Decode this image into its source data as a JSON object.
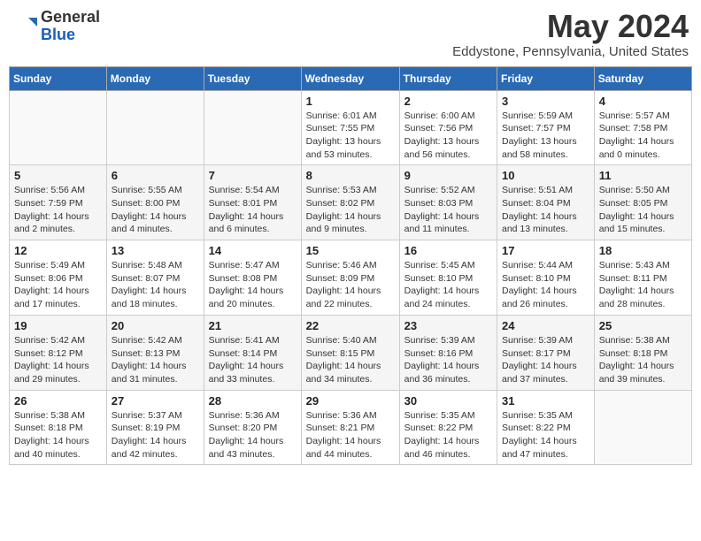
{
  "logo": {
    "general": "General",
    "blue": "Blue"
  },
  "title": "May 2024",
  "subtitle": "Eddystone, Pennsylvania, United States",
  "days_of_week": [
    "Sunday",
    "Monday",
    "Tuesday",
    "Wednesday",
    "Thursday",
    "Friday",
    "Saturday"
  ],
  "weeks": [
    [
      {
        "day": "",
        "info": ""
      },
      {
        "day": "",
        "info": ""
      },
      {
        "day": "",
        "info": ""
      },
      {
        "day": "1",
        "info": "Sunrise: 6:01 AM\nSunset: 7:55 PM\nDaylight: 13 hours\nand 53 minutes."
      },
      {
        "day": "2",
        "info": "Sunrise: 6:00 AM\nSunset: 7:56 PM\nDaylight: 13 hours\nand 56 minutes."
      },
      {
        "day": "3",
        "info": "Sunrise: 5:59 AM\nSunset: 7:57 PM\nDaylight: 13 hours\nand 58 minutes."
      },
      {
        "day": "4",
        "info": "Sunrise: 5:57 AM\nSunset: 7:58 PM\nDaylight: 14 hours\nand 0 minutes."
      }
    ],
    [
      {
        "day": "5",
        "info": "Sunrise: 5:56 AM\nSunset: 7:59 PM\nDaylight: 14 hours\nand 2 minutes."
      },
      {
        "day": "6",
        "info": "Sunrise: 5:55 AM\nSunset: 8:00 PM\nDaylight: 14 hours\nand 4 minutes."
      },
      {
        "day": "7",
        "info": "Sunrise: 5:54 AM\nSunset: 8:01 PM\nDaylight: 14 hours\nand 6 minutes."
      },
      {
        "day": "8",
        "info": "Sunrise: 5:53 AM\nSunset: 8:02 PM\nDaylight: 14 hours\nand 9 minutes."
      },
      {
        "day": "9",
        "info": "Sunrise: 5:52 AM\nSunset: 8:03 PM\nDaylight: 14 hours\nand 11 minutes."
      },
      {
        "day": "10",
        "info": "Sunrise: 5:51 AM\nSunset: 8:04 PM\nDaylight: 14 hours\nand 13 minutes."
      },
      {
        "day": "11",
        "info": "Sunrise: 5:50 AM\nSunset: 8:05 PM\nDaylight: 14 hours\nand 15 minutes."
      }
    ],
    [
      {
        "day": "12",
        "info": "Sunrise: 5:49 AM\nSunset: 8:06 PM\nDaylight: 14 hours\nand 17 minutes."
      },
      {
        "day": "13",
        "info": "Sunrise: 5:48 AM\nSunset: 8:07 PM\nDaylight: 14 hours\nand 18 minutes."
      },
      {
        "day": "14",
        "info": "Sunrise: 5:47 AM\nSunset: 8:08 PM\nDaylight: 14 hours\nand 20 minutes."
      },
      {
        "day": "15",
        "info": "Sunrise: 5:46 AM\nSunset: 8:09 PM\nDaylight: 14 hours\nand 22 minutes."
      },
      {
        "day": "16",
        "info": "Sunrise: 5:45 AM\nSunset: 8:10 PM\nDaylight: 14 hours\nand 24 minutes."
      },
      {
        "day": "17",
        "info": "Sunrise: 5:44 AM\nSunset: 8:10 PM\nDaylight: 14 hours\nand 26 minutes."
      },
      {
        "day": "18",
        "info": "Sunrise: 5:43 AM\nSunset: 8:11 PM\nDaylight: 14 hours\nand 28 minutes."
      }
    ],
    [
      {
        "day": "19",
        "info": "Sunrise: 5:42 AM\nSunset: 8:12 PM\nDaylight: 14 hours\nand 29 minutes."
      },
      {
        "day": "20",
        "info": "Sunrise: 5:42 AM\nSunset: 8:13 PM\nDaylight: 14 hours\nand 31 minutes."
      },
      {
        "day": "21",
        "info": "Sunrise: 5:41 AM\nSunset: 8:14 PM\nDaylight: 14 hours\nand 33 minutes."
      },
      {
        "day": "22",
        "info": "Sunrise: 5:40 AM\nSunset: 8:15 PM\nDaylight: 14 hours\nand 34 minutes."
      },
      {
        "day": "23",
        "info": "Sunrise: 5:39 AM\nSunset: 8:16 PM\nDaylight: 14 hours\nand 36 minutes."
      },
      {
        "day": "24",
        "info": "Sunrise: 5:39 AM\nSunset: 8:17 PM\nDaylight: 14 hours\nand 37 minutes."
      },
      {
        "day": "25",
        "info": "Sunrise: 5:38 AM\nSunset: 8:18 PM\nDaylight: 14 hours\nand 39 minutes."
      }
    ],
    [
      {
        "day": "26",
        "info": "Sunrise: 5:38 AM\nSunset: 8:18 PM\nDaylight: 14 hours\nand 40 minutes."
      },
      {
        "day": "27",
        "info": "Sunrise: 5:37 AM\nSunset: 8:19 PM\nDaylight: 14 hours\nand 42 minutes."
      },
      {
        "day": "28",
        "info": "Sunrise: 5:36 AM\nSunset: 8:20 PM\nDaylight: 14 hours\nand 43 minutes."
      },
      {
        "day": "29",
        "info": "Sunrise: 5:36 AM\nSunset: 8:21 PM\nDaylight: 14 hours\nand 44 minutes."
      },
      {
        "day": "30",
        "info": "Sunrise: 5:35 AM\nSunset: 8:22 PM\nDaylight: 14 hours\nand 46 minutes."
      },
      {
        "day": "31",
        "info": "Sunrise: 5:35 AM\nSunset: 8:22 PM\nDaylight: 14 hours\nand 47 minutes."
      },
      {
        "day": "",
        "info": ""
      }
    ]
  ]
}
